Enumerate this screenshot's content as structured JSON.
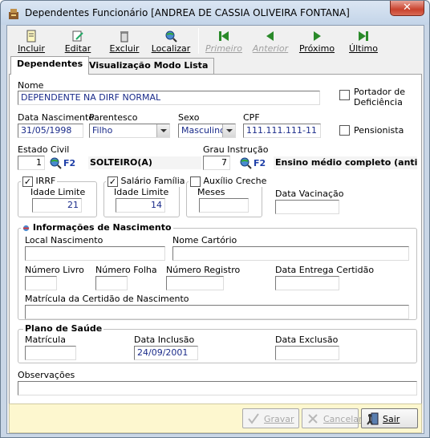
{
  "window": {
    "title": "Dependentes Funcionário [ANDREA DE CASSIA OLIVEIRA FONTANA]"
  },
  "toolbar": {
    "incluir": "Incluir",
    "editar": "Editar",
    "excluir": "Excluir",
    "localizar": "Localizar",
    "primeiro": "Primeiro",
    "anterior": "Anterior",
    "proximo": "Próximo",
    "ultimo": "Último"
  },
  "tabs": {
    "dependentes": "Dependentes",
    "lista": "Visualização Modo Lista"
  },
  "form": {
    "nome_label": "Nome",
    "nome_value": "DEPENDENTE NA DIRF NORMAL",
    "portador_label": "Portador de Deficiência",
    "pensionista_label": "Pensionista",
    "nascimento_label": "Data Nascimento",
    "nascimento_value": "31/05/1998",
    "parentesco_label": "Parentesco",
    "parentesco_value": "Filho",
    "sexo_label": "Sexo",
    "sexo_value": "Masculino",
    "cpf_label": "CPF",
    "cpf_value": "111.111.111-11",
    "estado_civil_label": "Estado Civil",
    "estado_civil_code": "1",
    "estado_civil_desc": "SOLTEIRO(A)",
    "grau_label": "Grau Instrução",
    "grau_code": "7",
    "grau_desc": "Ensino médio completo (antigo",
    "f2": "F2",
    "irrf_label": "IRRF",
    "irrf_check": "✓",
    "irrf_idade_label": "Idade Limite",
    "irrf_idade_value": "21",
    "salario_label": "Salário Família",
    "salario_check": "✓",
    "salario_idade_label": "Idade Limite",
    "salario_idade_value": "14",
    "creche_label": "Auxílio Creche",
    "creche_meses_label": "Meses",
    "vacinacao_label": "Data Vacinação"
  },
  "nascimento_group": {
    "title": "Informações de Nascimento",
    "local_label": "Local Nascimento",
    "cartorio_label": "Nome Cartório",
    "livro_label": "Número Livro",
    "folha_label": "Número Folha",
    "registro_label": "Número Registro",
    "entrega_label": "Data Entrega Certidão",
    "matricula_label": "Matrícula da Certidão de Nascimento"
  },
  "plano": {
    "title": "Plano de Saúde",
    "matricula_label": "Matrícula",
    "inclusao_label": "Data Inclusão",
    "inclusao_value": "24/09/2001",
    "exclusao_label": "Data Exclusão"
  },
  "observacoes_label": "Observações",
  "footer": {
    "gravar": "Gravar",
    "cancelar": "Cancelar",
    "sair": "Sair"
  }
}
